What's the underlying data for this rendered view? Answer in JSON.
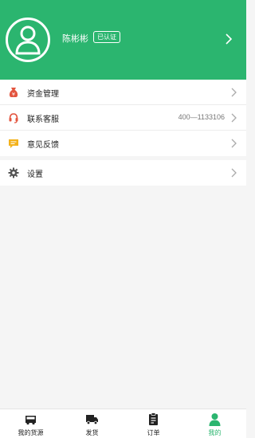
{
  "profile": {
    "name": "陈彬彬",
    "verified_badge": "已认证"
  },
  "menu": {
    "funds": "资金管理",
    "support": "联系客服",
    "support_phone": "400—1133106",
    "feedback": "意见反馈",
    "settings": "设置"
  },
  "tabs": {
    "cargo": "我的货源",
    "ship": "发货",
    "orders": "订单",
    "mine": "我的"
  },
  "colors": {
    "accent": "#2bb56f",
    "funds_icon": "#e3553f",
    "support_icon": "#e3553f",
    "feedback_icon": "#f3b21c"
  },
  "icons": {
    "avatar": "user-silhouette-icon",
    "funds": "money-bag-icon",
    "support": "headset-icon",
    "feedback": "message-icon",
    "settings": "gear-icon",
    "cargo": "truck-icon",
    "ship": "delivery-truck-icon",
    "orders": "clipboard-icon",
    "mine": "user-icon"
  }
}
